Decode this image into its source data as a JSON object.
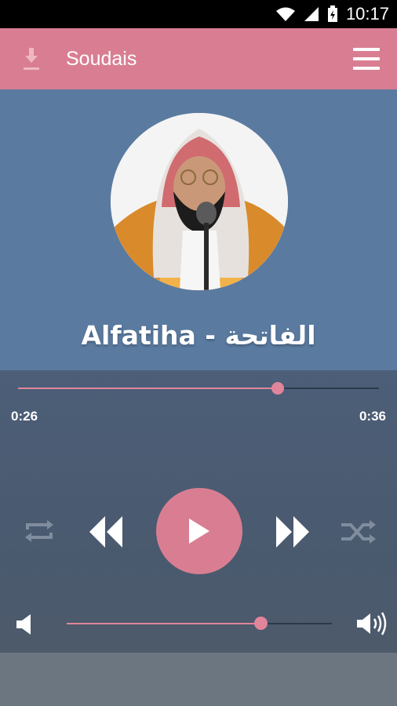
{
  "status_bar": {
    "time": "10:17"
  },
  "app_bar": {
    "title": "Soudais"
  },
  "now_playing": {
    "title": "Alfatiha - الفاتحة"
  },
  "playback": {
    "elapsed": "0:26",
    "total": "0:36",
    "progress": 0.72
  },
  "volume": {
    "level": 0.73
  },
  "colors": {
    "accent": "#d97e92",
    "hero_background": "#5a7aa0",
    "player_background": "#4a5a6e"
  },
  "icons": [
    "download-icon",
    "menu-icon",
    "repeat-icon",
    "rewind-icon",
    "play-icon",
    "fast-forward-icon",
    "shuffle-icon",
    "volume-low-icon",
    "volume-high-icon"
  ]
}
